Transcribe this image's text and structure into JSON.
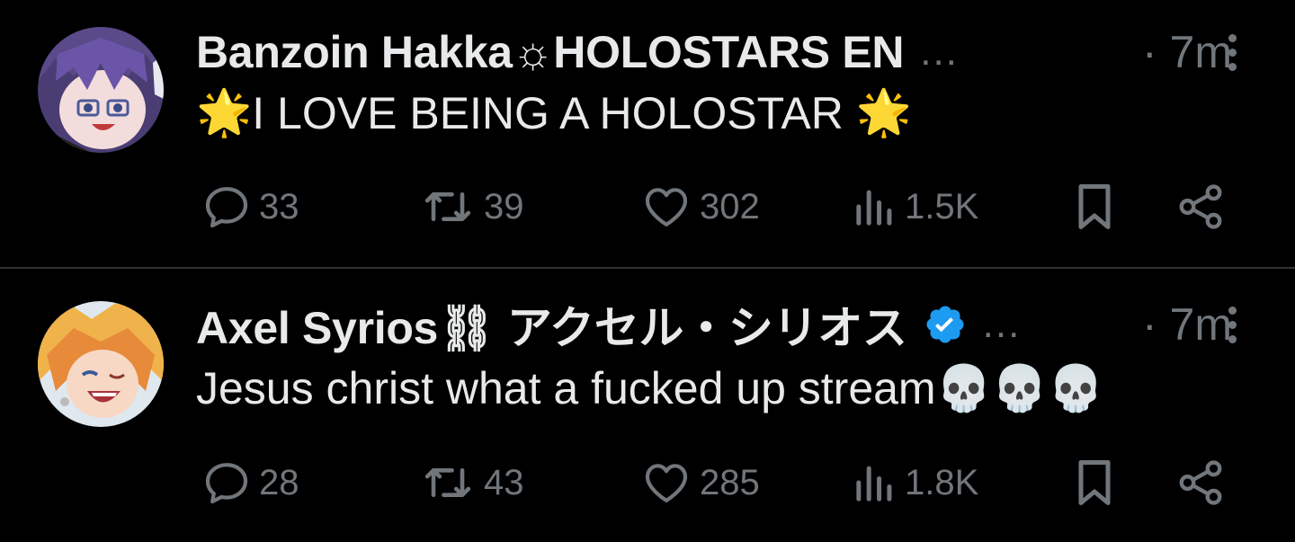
{
  "tweets": [
    {
      "display_name": "Banzoin Hakka☼HOLOSTARS EN",
      "ellipsis": "...",
      "time": "· 7m",
      "text": "I LOVE BEING A HOLOSTAR",
      "text_prefix_emoji": "🌟",
      "text_suffix_emoji": "🌟",
      "verified": false,
      "stats": {
        "replies": "33",
        "reposts": "39",
        "likes": "302",
        "views": "1.5K"
      }
    },
    {
      "display_name": "Axel Syrios⛓ アクセル・シリオス",
      "ellipsis": "...",
      "time": "· 7m",
      "text": "Jesus christ what a fucked up stream💀💀💀",
      "verified": true,
      "stats": {
        "replies": "28",
        "reposts": "43",
        "likes": "285",
        "views": "1.8K"
      }
    }
  ],
  "colors": {
    "background": "#000000",
    "text": "#e7e9ea",
    "muted": "#71767b",
    "divider": "#2f3336",
    "verified": "#1d9bf0"
  },
  "icons": [
    "more-icon",
    "reply-icon",
    "repost-icon",
    "like-icon",
    "views-icon",
    "bookmark-icon",
    "share-icon",
    "verified-badge-icon"
  ]
}
